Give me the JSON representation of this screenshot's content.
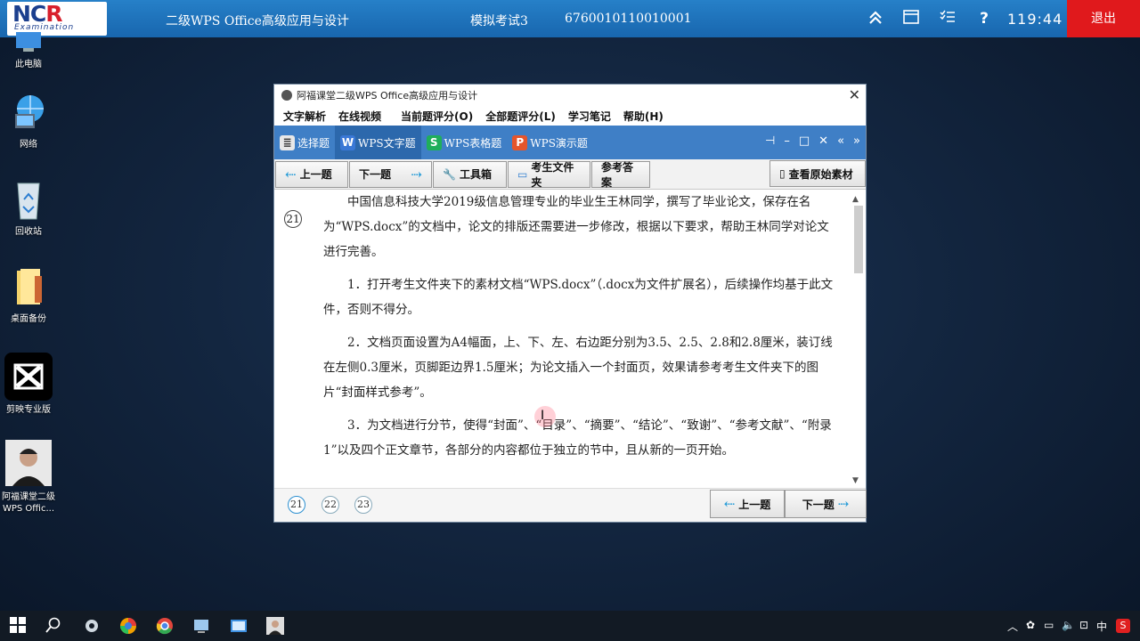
{
  "topbar": {
    "logo_text_a": "NC",
    "logo_text_b": "R",
    "logo_sub": "Examination",
    "course": "二级WPS Office高级应用与设计",
    "exam": "模拟考试3",
    "ticket": "6760010110010001",
    "timer": "119:44",
    "exit": "退出"
  },
  "desktop": [
    {
      "label": "此电脑"
    },
    {
      "label": "网络"
    },
    {
      "label": "回收站"
    },
    {
      "label": "桌面备份"
    },
    {
      "label": "剪映专业版"
    },
    {
      "label": "阿福课堂二级\nWPS Offic..."
    }
  ],
  "window": {
    "title": "阿福课堂二级WPS Office高级应用与设计",
    "menu": [
      "文字解析",
      "在线视频",
      "当前题评分(O)",
      "全部题评分(L)",
      "学习笔记",
      "帮助(H)"
    ],
    "tabs": [
      {
        "label": "选择题",
        "icon": "≣",
        "color": "#eaeaea"
      },
      {
        "label": "WPS文字题",
        "icon": "W",
        "color": "#3a78d6"
      },
      {
        "label": "WPS表格题",
        "icon": "S",
        "color": "#1fae5b"
      },
      {
        "label": "WPS演示题",
        "icon": "P",
        "color": "#e5552b"
      }
    ],
    "toolbar": {
      "prev": "上一题",
      "next": "下一题",
      "tools": "工具箱",
      "folder": "考生文件夹",
      "answer": "参考答案",
      "source": "查看原始素材"
    },
    "question_number": "21",
    "paragraphs": [
      "中国信息科技大学2019级信息管理专业的毕业生王林同学，撰写了毕业论文，保存在名为“WPS.docx”的文档中，论文的排版还需要进一步修改，根据以下要求，帮助王林同学对论文进行完善。",
      "1．打开考生文件夹下的素材文档“WPS.docx”（.docx为文件扩展名），后续操作均基于此文件，否则不得分。",
      "2．文档页面设置为A4幅面，上、下、左、右边距分别为3.5、2.5、2.8和2.8厘米，装订线在左侧0.3厘米，页脚距边界1.5厘米；为论文插入一个封面页，效果请参考考生文件夹下的图片“封面样式参考”。",
      "3．为文档进行分节，使得“封面”、“目录”、“摘要”、“结论”、“致谢”、“参考文献”、“附录1”以及四个正文章节，各部分的内容都位于独立的节中，且从新的一页开始。"
    ],
    "pages": [
      "21",
      "22",
      "23"
    ],
    "footer": {
      "prev": "上一题",
      "next": "下一题"
    }
  },
  "tray": {
    "ime": "中",
    "clock_icon": "clock-icon"
  }
}
